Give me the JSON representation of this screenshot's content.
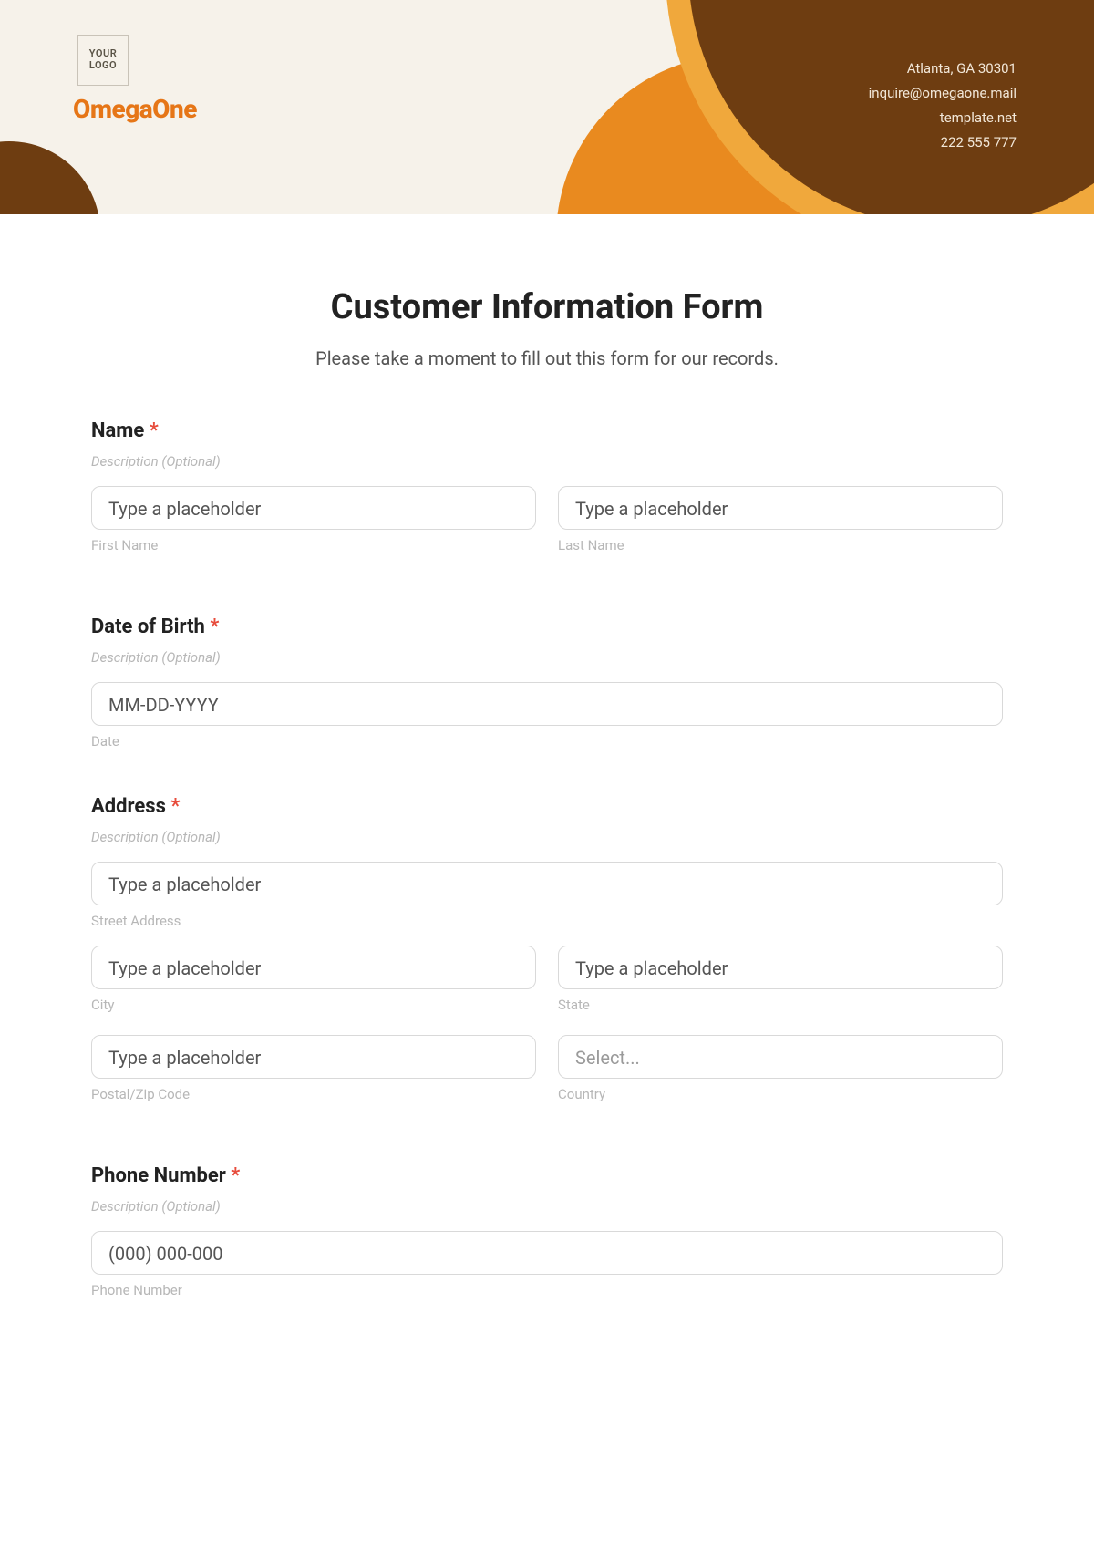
{
  "header": {
    "logo_text": "YOUR\nLOGO",
    "brand": "OmegaOne",
    "contact": {
      "address": "Atlanta, GA 30301",
      "email": "inquire@omegaone.mail",
      "website": "template.net",
      "phone": "222 555 777"
    }
  },
  "form": {
    "title": "Customer Information Form",
    "subtitle": "Please take a moment to fill out this form for our records.",
    "required_mark": "*",
    "sections": {
      "name": {
        "label": "Name",
        "desc": "Description (Optional)",
        "first_placeholder": "Type a placeholder",
        "first_sublabel": "First Name",
        "last_placeholder": "Type a placeholder",
        "last_sublabel": "Last Name"
      },
      "dob": {
        "label": "Date of Birth",
        "desc": "Description (Optional)",
        "placeholder": "MM-DD-YYYY",
        "sublabel": "Date"
      },
      "address": {
        "label": "Address",
        "desc": "Description (Optional)",
        "street_placeholder": "Type a placeholder",
        "street_sublabel": "Street Address",
        "city_placeholder": "Type a placeholder",
        "city_sublabel": "City",
        "state_placeholder": "Type a placeholder",
        "state_sublabel": "State",
        "postal_placeholder": "Type a placeholder",
        "postal_sublabel": "Postal/Zip Code",
        "country_placeholder": "Select...",
        "country_sublabel": "Country"
      },
      "phone": {
        "label": "Phone Number",
        "desc": "Description (Optional)",
        "placeholder": "(000) 000-000",
        "sublabel": "Phone Number"
      }
    }
  }
}
